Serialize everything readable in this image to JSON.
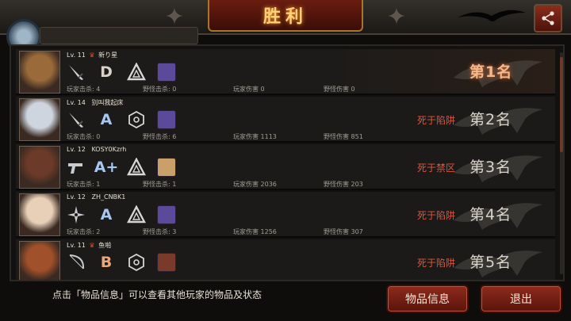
{
  "header": {
    "title": "胜利",
    "share_icon": "share-icon"
  },
  "players": [
    {
      "level": "Lv. 11",
      "crown": true,
      "name": "新り星",
      "grade": "D",
      "grade_color": "#d8d2c6",
      "weapon": "knife",
      "stats": {
        "player_kills": "玩家击杀: 4",
        "monster_kills": "野怪击杀: 0",
        "player_damage": "玩家伤害 0",
        "monster_damage": "野怪伤害 0"
      },
      "death": "",
      "rank": "第1名",
      "avatar_color": "#9a6a3a"
    },
    {
      "level": "Lv. 14",
      "crown": false,
      "name": "别叫我起床",
      "grade": "A",
      "grade_color": "#a7c7f0",
      "weapon": "knife",
      "stats": {
        "player_kills": "玩家击杀: 0",
        "monster_kills": "野怪击杀: 6",
        "player_damage": "玩家伤害 1113",
        "monster_damage": "野怪伤害 851"
      },
      "death": "死于陷阱",
      "rank": "第2名",
      "avatar_color": "#cfd5de"
    },
    {
      "level": "Lv. 12",
      "crown": false,
      "name": "KOSY0Kzrh",
      "grade": "A+",
      "grade_color": "#a7c7f0",
      "weapon": "gun",
      "stats": {
        "player_kills": "玩家击杀: 1",
        "monster_kills": "野怪击杀: 1",
        "player_damage": "玩家伤害 2036",
        "monster_damage": "野怪伤害 203"
      },
      "death": "死于禁区",
      "rank": "第3名",
      "avatar_color": "#6b3a28"
    },
    {
      "level": "Lv. 12",
      "crown": false,
      "name": "ZH_CNBK1",
      "grade": "A",
      "grade_color": "#a7c7f0",
      "weapon": "shuriken",
      "stats": {
        "player_kills": "玩家击杀: 2",
        "monster_kills": "野怪击杀: 3",
        "player_damage": "玩家伤害 1256",
        "monster_damage": "野怪伤害 307"
      },
      "death": "死于陷阱",
      "rank": "第4名",
      "avatar_color": "#e8cfb8"
    },
    {
      "level": "Lv. 11",
      "crown": true,
      "name": "鱼啪",
      "grade": "B",
      "grade_color": "#e8a87a",
      "weapon": "bow",
      "stats": {
        "player_kills": "",
        "monster_kills": "",
        "player_damage": "",
        "monster_damage": ""
      },
      "death": "死于陷阱",
      "rank": "第5名",
      "avatar_color": "#a0502a"
    }
  ],
  "footer": {
    "hint": "点击「物品信息」可以查看其他玩家的物品及状态",
    "info_button": "物品信息",
    "exit_button": "退出"
  },
  "colors": {
    "accent": "#8e2a1c",
    "death_text": "#e0533a",
    "rank_first": "#f2b98a"
  }
}
